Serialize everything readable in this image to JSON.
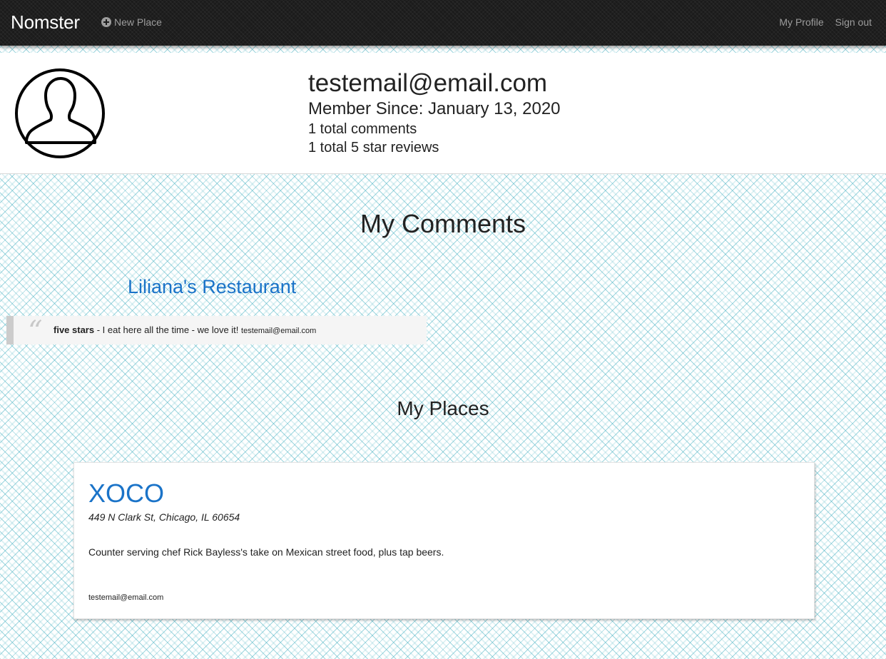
{
  "navbar": {
    "brand": "Nomster",
    "new_place_label": "New Place",
    "new_place_icon": "plus-circle-icon",
    "my_profile_label": "My Profile",
    "sign_out_label": "Sign out",
    "text_color": "#9d9d9d",
    "background_color": "#1b1b1b"
  },
  "profile": {
    "avatar_icon": "user-silhouette-icon",
    "email": "testemail@email.com",
    "member_since": "Member Since: January 13, 2020",
    "total_comments": "1 total comments",
    "five_star_reviews": "1 total 5 star reviews"
  },
  "comments_section": {
    "title": "My Comments",
    "items": [
      {
        "place_name": "Liliana's Restaurant",
        "rating": "five stars",
        "text": " - I eat here all the time - we love it! ",
        "author": "testemail@email.com"
      }
    ]
  },
  "places_section": {
    "title": "My Places",
    "items": [
      {
        "name": "XOCO",
        "address": "449 N Clark St, Chicago, IL 60654",
        "description": "Counter serving chef Rick Bayless's take on Mexican street food, plus tap beers.",
        "owner": "testemail@email.com"
      }
    ]
  },
  "colors": {
    "link": "#1a73c8",
    "pattern": "#4fb4c4"
  }
}
